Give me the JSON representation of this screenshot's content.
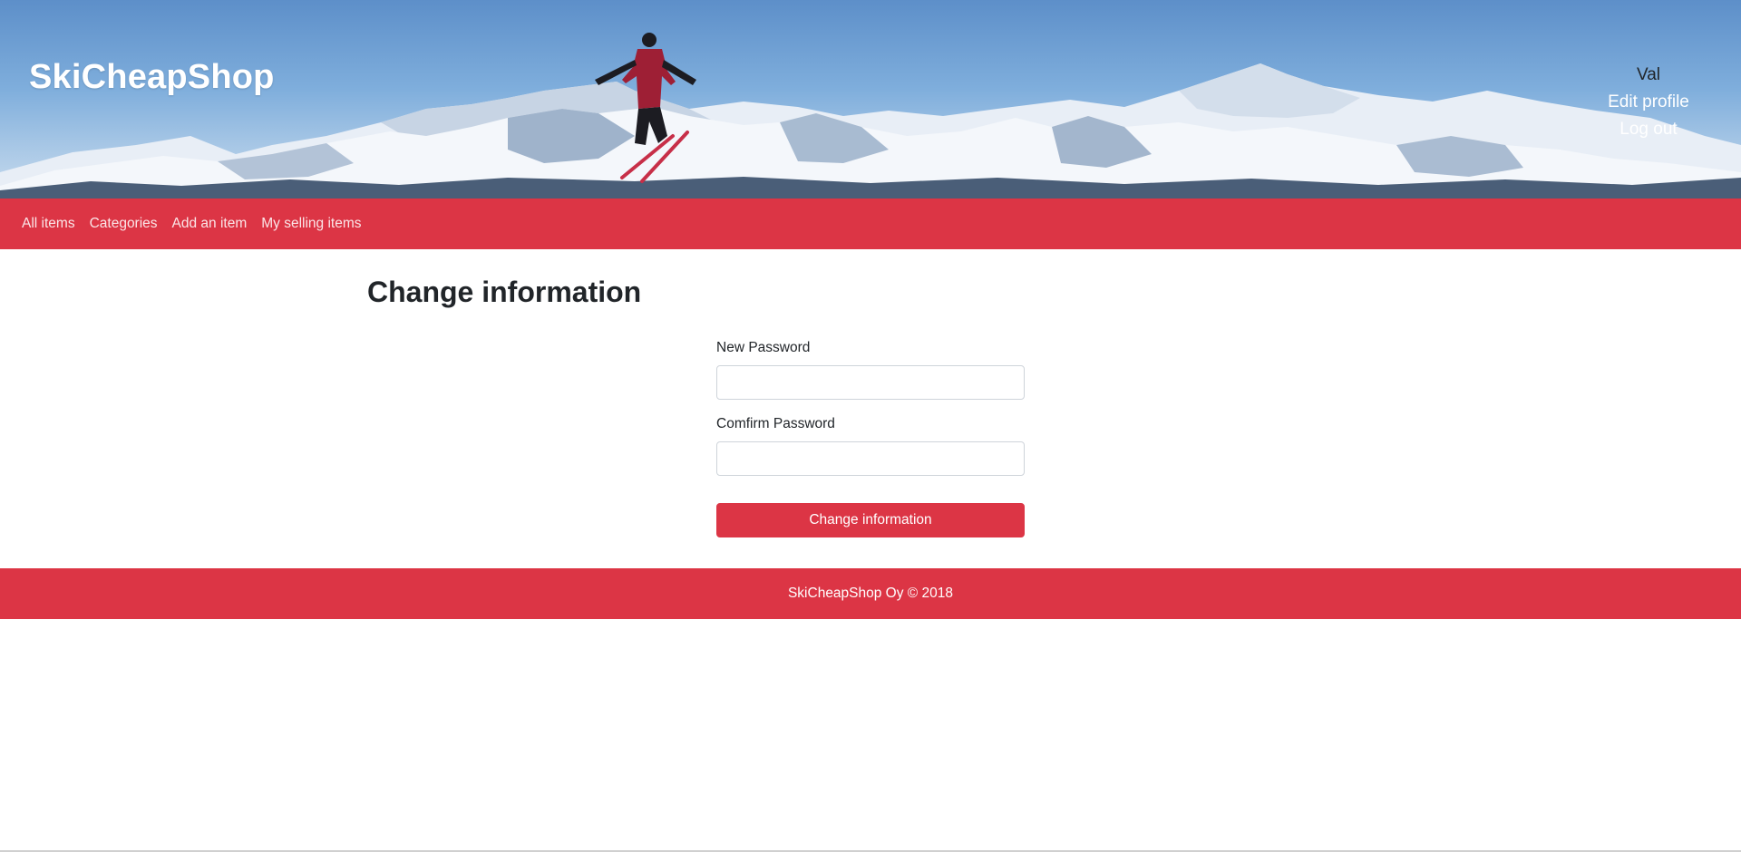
{
  "header": {
    "site_title": "SkiCheapShop",
    "banner_image": "ski-jumper-over-snowy-mountains",
    "user_menu": {
      "user_name": "Val",
      "edit_profile": "Edit profile",
      "log_out": "Log out"
    }
  },
  "nav": {
    "items": [
      {
        "label": "All items"
      },
      {
        "label": "Categories"
      },
      {
        "label": "Add an item"
      },
      {
        "label": "My selling items"
      }
    ]
  },
  "main": {
    "title": "Change information",
    "form": {
      "new_password_label": "New Password",
      "new_password_value": "",
      "confirm_password_label": "Comfirm Password",
      "confirm_password_value": "",
      "submit_label": "Change information"
    }
  },
  "footer": {
    "text": "SkiCheapShop Oy © 2018"
  },
  "colors": {
    "accent": "#dc3545",
    "text": "#212529",
    "sky": "#7faedc"
  }
}
